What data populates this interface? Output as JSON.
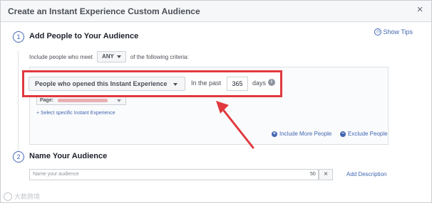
{
  "dialog": {
    "title": "Create an Instant Experience Custom Audience",
    "close_symbol": "×",
    "show_tips": "Show Tips"
  },
  "step1": {
    "number": "1",
    "title": "Add People to Your Audience",
    "include_prefix": "Include people who meet",
    "match_value": "ANY",
    "include_suffix": "of the following criteria:",
    "criteria": {
      "event": "People who opened this Instant Experience",
      "in_the_past": "In the past",
      "days_value": "365",
      "days_label": "days",
      "info_symbol": "i"
    },
    "page_label": "Page:",
    "select_specific": "+ Select specific Instant Experience",
    "include_more": "Include More People",
    "exclude": "Exclude People"
  },
  "step2": {
    "number": "2",
    "title": "Name Your Audience",
    "name_placeholder": "Name your audience",
    "char_count": "50",
    "clear_symbol": "×",
    "add_description": "Add Description"
  },
  "watermark": {
    "text": "大数跨境"
  },
  "colors": {
    "accent": "#4267b2",
    "highlight_border": "#e0393e",
    "arrow": "#e0393e"
  },
  "icons": [
    "close-icon",
    "info-icon",
    "plus-circle-icon",
    "minus-circle-icon",
    "chevron-down-icon",
    "tips-icon",
    "arrow-annotation"
  ]
}
